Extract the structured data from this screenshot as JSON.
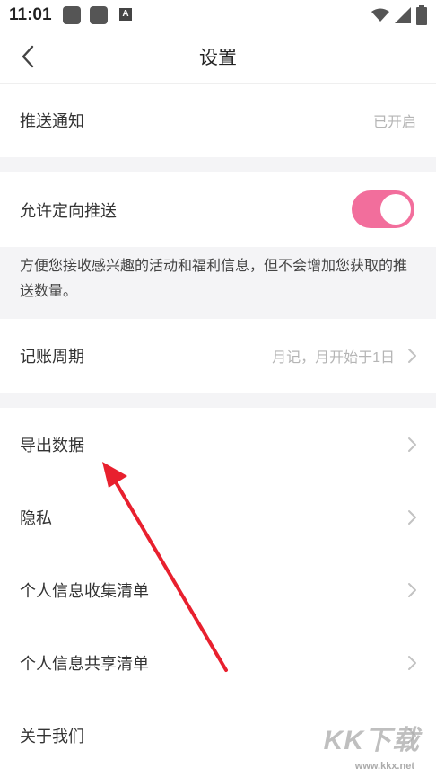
{
  "status_bar": {
    "time": "11:01",
    "notification_icon_label": "A"
  },
  "header": {
    "title": "设置"
  },
  "settings": {
    "push_notification": {
      "label": "推送通知",
      "value": "已开启"
    },
    "targeted_push": {
      "label": "允许定向推送",
      "enabled": true,
      "description": "方便您接收感兴趣的活动和福利信息，但不会增加您获取的推送数量。"
    },
    "billing_cycle": {
      "label": "记账周期",
      "value": "月记，月开始于1日"
    },
    "export_data": {
      "label": "导出数据"
    },
    "privacy": {
      "label": "隐私"
    },
    "personal_info_collection": {
      "label": "个人信息收集清单"
    },
    "personal_info_sharing": {
      "label": "个人信息共享清单"
    },
    "about_us": {
      "label": "关于我们"
    }
  },
  "colors": {
    "accent": "#f26e9c",
    "annotation_arrow": "#e8202e",
    "section_gap": "#f4f4f6"
  },
  "icons": {
    "back": "chevron-left-icon",
    "row_chevron": "chevron-right-icon"
  },
  "watermark": {
    "text": "KK下载",
    "url": "www.kkx.net"
  }
}
